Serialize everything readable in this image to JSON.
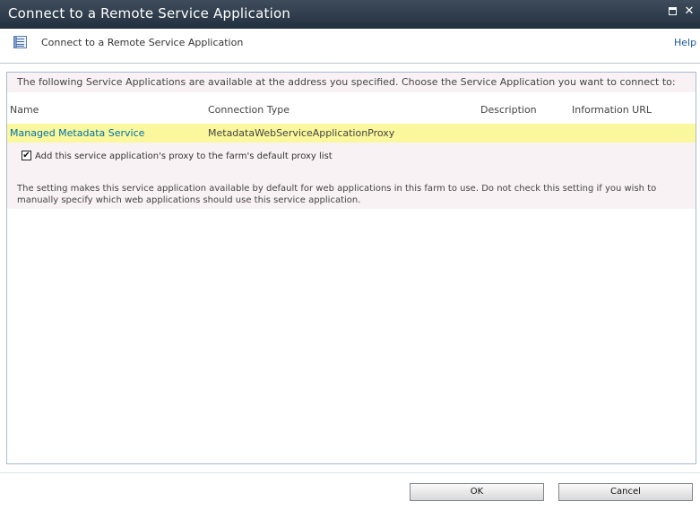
{
  "window": {
    "title": "Connect to a Remote Service Application",
    "close_glyph": "✕",
    "icons": [
      "maximize-icon",
      "close-icon"
    ]
  },
  "header": {
    "title": "Connect to a Remote Service Application",
    "help_label": "Help",
    "icon": "page-list-icon"
  },
  "content": {
    "intro": "The following Service Applications are available at the address you specified. Choose the Service Application you want to connect to:",
    "columns": [
      "Name",
      "Connection Type",
      "Description",
      "Information URL"
    ],
    "rows": [
      {
        "name": "Managed Metadata Service",
        "connection_type": "MetadataWebServiceApplicationProxy",
        "description": "",
        "information_url": ""
      }
    ],
    "checkbox": {
      "label": "Add this service application's proxy to the farm's default proxy list",
      "checked": true,
      "check_glyph": "✔"
    },
    "note": "The setting makes this service application available by default for web applications in this farm to use. Do not check this setting if you wish to manually specify which web applications should use this service application."
  },
  "buttons": {
    "ok_label": "OK",
    "cancel_label": "Cancel"
  },
  "colors": {
    "titlebar": "#2b3848",
    "link": "#0071a9",
    "row_highlight": "#faf79c",
    "panel_border": "#a9bcd1",
    "section_bg": "#f8f2f5"
  }
}
